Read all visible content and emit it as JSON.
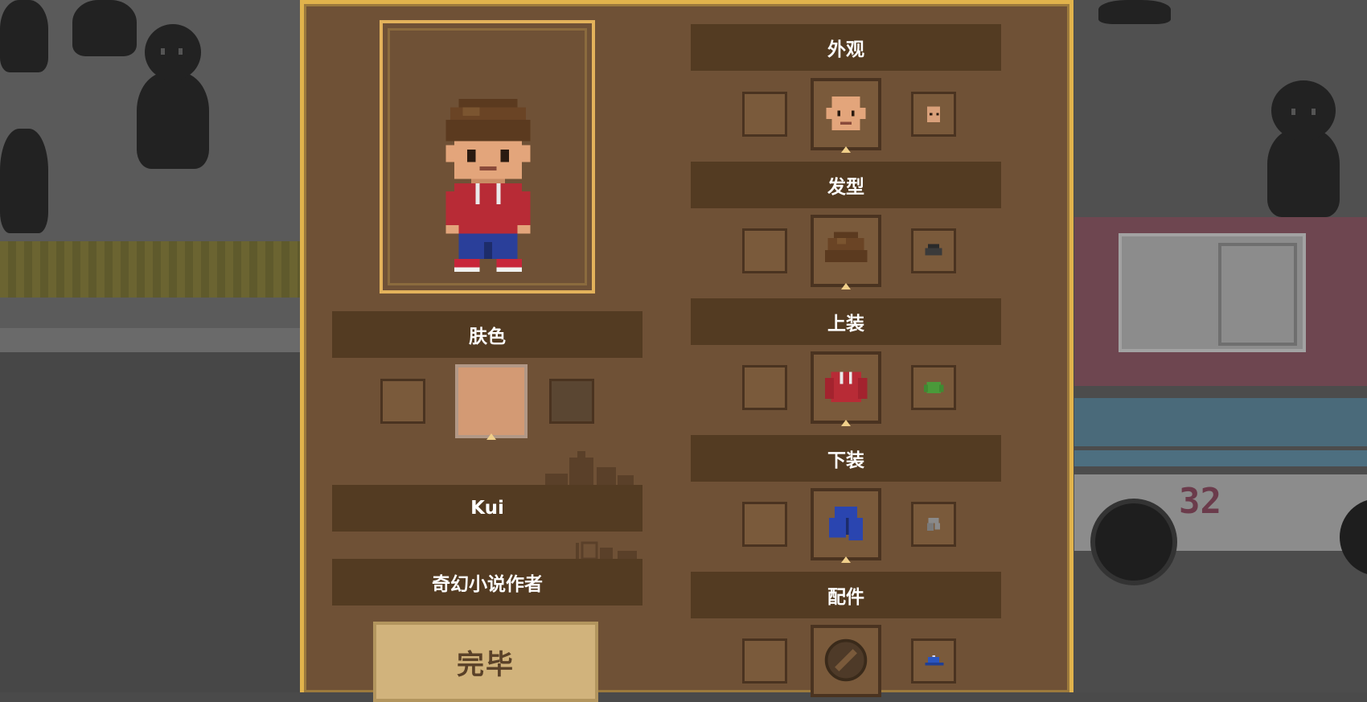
{
  "skin": {
    "label": "肤色"
  },
  "name": {
    "value": "Kui"
  },
  "occupation": {
    "value": "奇幻小说作者"
  },
  "done": {
    "label": "完毕"
  },
  "categories": [
    {
      "label": "外观",
      "icon": "face-icon"
    },
    {
      "label": "发型",
      "icon": "hair-icon"
    },
    {
      "label": "上装",
      "icon": "red-hoodie-icon"
    },
    {
      "label": "下装",
      "icon": "blue-pants-icon"
    },
    {
      "label": "配件",
      "icon": "no-accessory-icon"
    }
  ],
  "background": {
    "bus_number": "32"
  },
  "colors": {
    "panel": "#6f5136",
    "border_gold": "#e1b34c",
    "label_bar": "#533b22",
    "skin_selected": "#d39a74",
    "button": "#d1b37c"
  }
}
